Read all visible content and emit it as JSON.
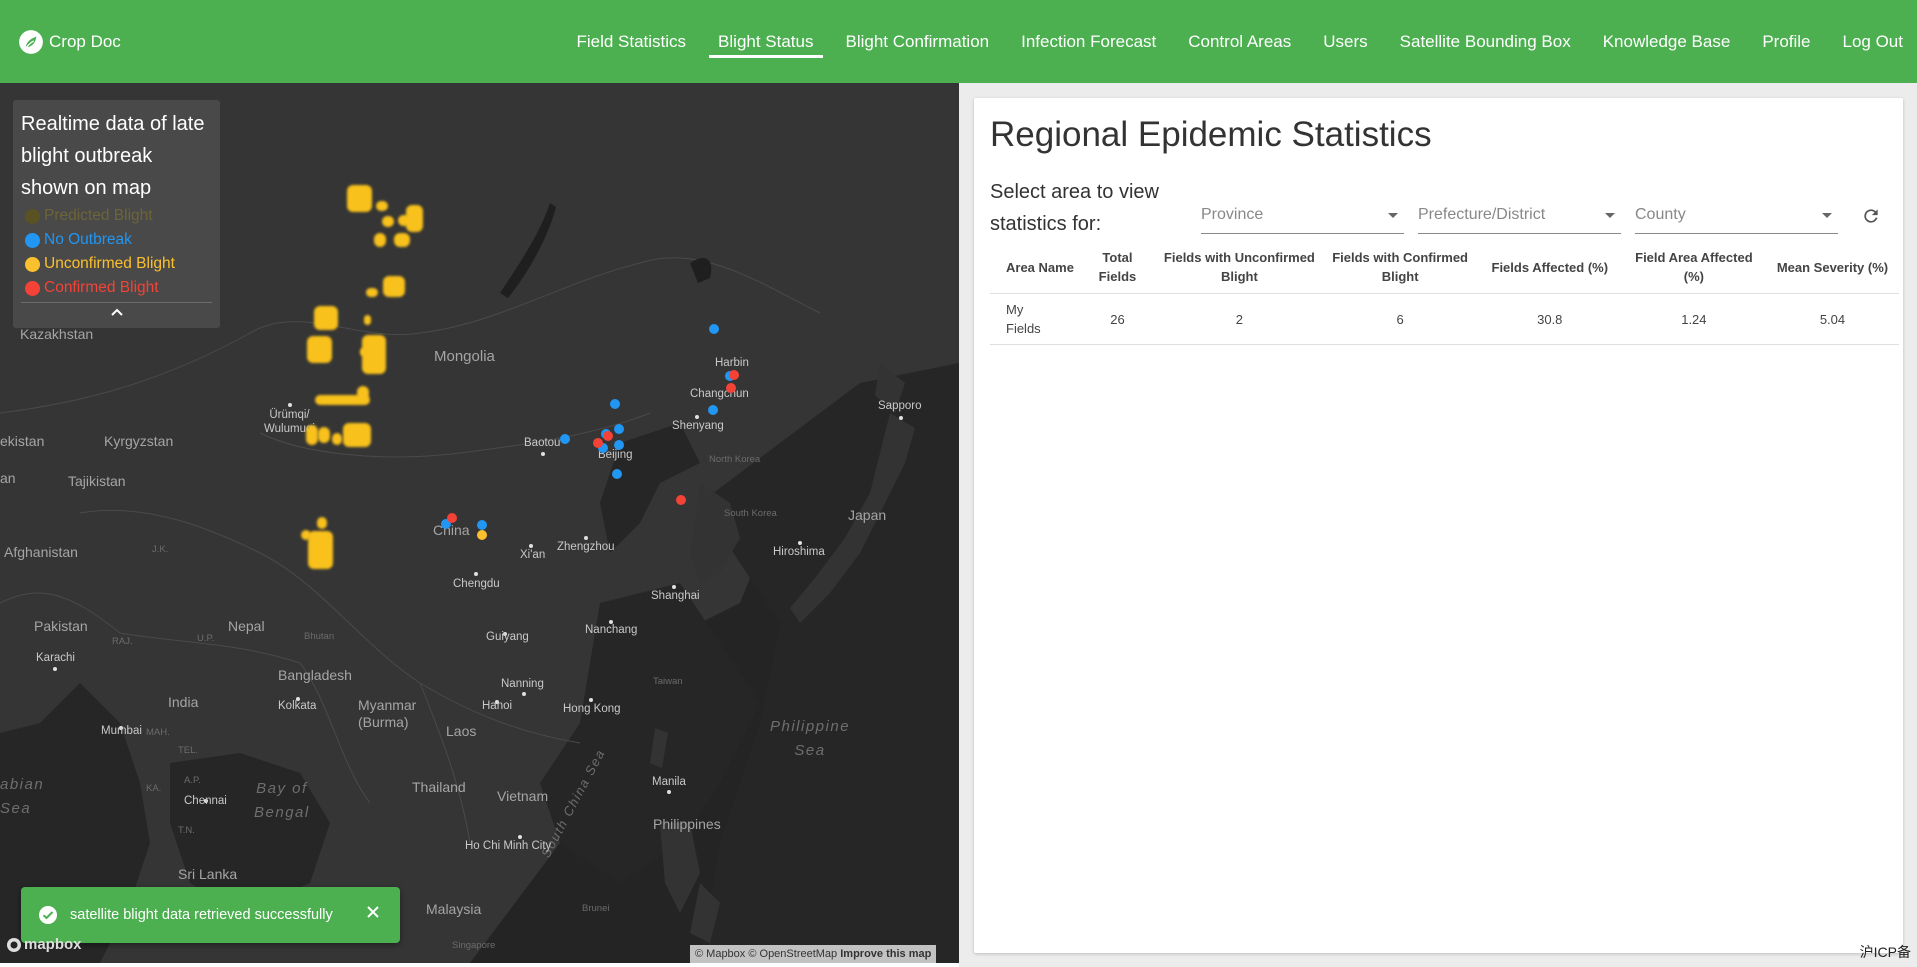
{
  "brand": {
    "name": "Crop Doc",
    "icon": "leaf-icon"
  },
  "nav": {
    "items": [
      "Field Statistics",
      "Blight Status",
      "Blight Confirmation",
      "Infection Forecast",
      "Control Areas",
      "Users",
      "Satellite Bounding Box",
      "Knowledge Base",
      "Profile",
      "Log Out"
    ],
    "active": "Blight Status"
  },
  "legend": {
    "title": "Realtime data of late blight outbreak shown on map",
    "items": [
      {
        "label": "Predicted Blight",
        "color": "#5b5223"
      },
      {
        "label": "No Outbreak",
        "color": "#2196f3"
      },
      {
        "label": "Unconfirmed Blight",
        "color": "#fbc02d"
      },
      {
        "label": "Confirmed Blight",
        "color": "#f44336"
      }
    ],
    "toggle_icon": "chevron-up-icon"
  },
  "map": {
    "labels": {
      "kazakhstan": "Kazakhstan",
      "mongolia": "Mongolia",
      "kyrgyzstan": "Kyrgyzstan",
      "tajikistan": "Tajikistan",
      "uzbekistan": "ekistan",
      "an": "an",
      "afghanistan": "Afghanistan",
      "pakistan": "Pakistan",
      "nepal": "Nepal",
      "bhutan": "Bhutan",
      "bangladesh": "Bangladesh",
      "india": "India",
      "myanmar": "Myanmar\n(Burma)",
      "laos": "Laos",
      "thailand": "Thailand",
      "vietnam": "Vietnam",
      "philippines": "Philippines",
      "malaysia": "Malaysia",
      "srilanka": "Sri Lanka",
      "china": "China",
      "japan": "Japan",
      "southkorea": "South Korea",
      "northkorea": "North Korea",
      "taiwan": "Taiwan",
      "brunei": "Brunei",
      "singapore": "Singapore",
      "jk": "J.K.",
      "raj": "RAJ.",
      "up": "U.P.",
      "mah": "MAH.",
      "tel": "TEL.",
      "ap": "A.P.",
      "ka": "KA.",
      "tn": "T.N.",
      "arabian": "abian\nSea",
      "bay": "Bay of\nBengal",
      "philsea": "Philippine\nSea",
      "scs": "South China Sea"
    },
    "cities": {
      "urumqi": "Ürümqi/\nWulumuqi",
      "baotou": "Baotou",
      "beijing": "Beijing",
      "harbin": "Harbin",
      "changchun": "Changchun",
      "shenyang": "Shenyang",
      "sapporo": "Sapporo",
      "xian": "Xi'an",
      "zhengzhou": "Zhengzhou",
      "hiroshima": "Hiroshima",
      "chengdu": "Chengdu",
      "shanghai": "Shanghai",
      "nanchang": "Nanchang",
      "guiyang": "Guiyang",
      "kolkata": "Kolkata",
      "nanning": "Nanning",
      "hanoi": "Hanoi",
      "hongkong": "Hong Kong",
      "karachi": "Karachi",
      "mumbai": "Mumbai",
      "chennai": "Chennai",
      "manila": "Manila",
      "hcmc": "Ho Chi Minh City"
    }
  },
  "snackbar": {
    "message": "satellite blight data retrieved successfully"
  },
  "mapbox": {
    "logo": "mapbox",
    "attrib_1": "© Mapbox © OpenStreetMap",
    "attrib_2": "Improve this map"
  },
  "panel": {
    "title": "Regional Epidemic Statistics",
    "select_label": "Select area to view statistics for:",
    "selects": [
      {
        "placeholder": "Province"
      },
      {
        "placeholder": "Prefecture/District"
      },
      {
        "placeholder": "County"
      }
    ],
    "table": {
      "headers": [
        "Area Name",
        "Total Fields",
        "Fields with Unconfirmed Blight",
        "Fields with Confirmed Blight",
        "Fields Affected (%)",
        "Field Area Affected (%)",
        "Mean Severity (%)"
      ],
      "rows": [
        [
          "My Fields",
          "26",
          "2",
          "6",
          "30.8",
          "1.24",
          "5.04"
        ]
      ]
    }
  },
  "footer": {
    "icp": "沪ICP备"
  }
}
